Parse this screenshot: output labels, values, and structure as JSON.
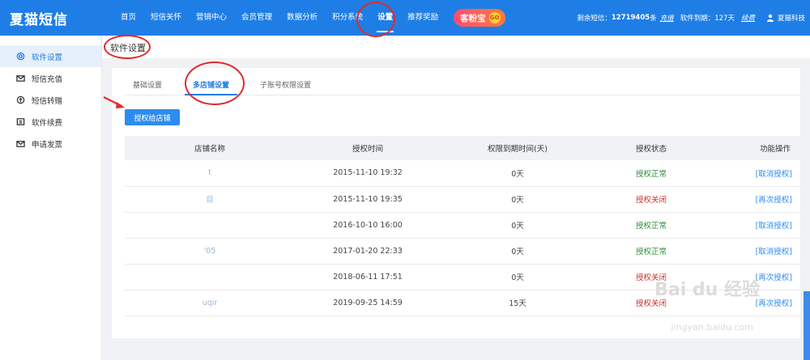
{
  "brand": "夏猫短信",
  "nav": [
    "首页",
    "短信关怀",
    "营销中心",
    "会员管理",
    "数据分析",
    "积分系统",
    "设置",
    "推荐奖励"
  ],
  "nav_active_index": 6,
  "promo": {
    "label": "客粉宝",
    "badge": "GO"
  },
  "top_right": {
    "sms_label": "剩余短信：",
    "sms_value": "12719405",
    "sms_unit": "条",
    "recharge": "充值",
    "expire_label": "软件到期：",
    "expire_value": "127天",
    "renew": "续费",
    "user": "夏猫科技"
  },
  "sidebar": [
    {
      "label": "软件设置",
      "icon": "gear-icon",
      "active": true
    },
    {
      "label": "短信充值",
      "icon": "envelope-icon",
      "active": false
    },
    {
      "label": "短信转赠",
      "icon": "transfer-icon",
      "active": false
    },
    {
      "label": "软件续费",
      "icon": "renew-icon",
      "active": false
    },
    {
      "label": "申请发票",
      "icon": "invoice-icon",
      "active": false
    }
  ],
  "page_title": "软件设置",
  "tabs": [
    {
      "label": "基础设置",
      "active": false
    },
    {
      "label": "多店铺设置",
      "active": true
    },
    {
      "label": "子账号权限设置",
      "active": false
    }
  ],
  "authorize_button": "授权给店铺",
  "table": {
    "headers": [
      "店铺名称",
      "授权时间",
      "权限到期时间(天)",
      "授权状态",
      "功能操作"
    ],
    "rows": [
      {
        "shop": "t",
        "time": "2015-11-10 19:32",
        "days": "0天",
        "status": "授权正常",
        "status_type": "ok",
        "op": "[取消授权]"
      },
      {
        "shop": "目",
        "time": "2015-11-10 19:35",
        "days": "0天",
        "status": "授权关闭",
        "status_type": "off",
        "op": "[再次授权]"
      },
      {
        "shop": "",
        "time": "2016-10-10 16:00",
        "days": "0天",
        "status": "授权正常",
        "status_type": "ok",
        "op": "[取消授权]"
      },
      {
        "shop": "'05",
        "time": "2017-01-20 22:33",
        "days": "0天",
        "status": "授权正常",
        "status_type": "ok",
        "op": "[取消授权]"
      },
      {
        "shop": "",
        "time": "2018-06-11 17:51",
        "days": "0天",
        "status": "授权关闭",
        "status_type": "off",
        "op": "[再次授权]"
      },
      {
        "shop": "uqir",
        "time": "2019-09-25 14:59",
        "days": "15天",
        "status": "授权关闭",
        "status_type": "off",
        "op": "[再次授权]"
      }
    ]
  },
  "watermark": {
    "main": "Bai du 经验",
    "sub": "jingyan.baidu.com"
  },
  "colors": {
    "primary": "#1e7ee6",
    "button": "#2d8cf0",
    "ok": "#2f8c3a",
    "off": "#c4342e",
    "annotation": "#e02b2b"
  }
}
